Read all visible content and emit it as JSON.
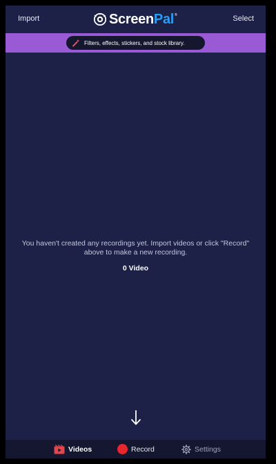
{
  "topbar": {
    "import_label": "Import",
    "select_label": "Select",
    "logo_text_a": "Screen",
    "logo_text_b": "Pal",
    "logo_tm": "®"
  },
  "promo": {
    "text": "Filters, effects, stickers, and stock library."
  },
  "empty_state": {
    "message": "You haven't created any recordings yet. Import videos or click \"Record\" above to make a new recording.",
    "count": "0 Video"
  },
  "bottomnav": {
    "videos_label": "Videos",
    "record_label": "Record",
    "settings_label": "Settings"
  },
  "colors": {
    "background": "#1d2148",
    "promo_band": "#9a5ad6",
    "brand_blue": "#2a9df4",
    "record_red": "#e8262e",
    "videos_icon_red": "#e0474c"
  },
  "icons": {
    "logo": "screenpal-eye-logo",
    "promo": "magic-wand-icon",
    "videos": "video-film-icon",
    "record": "record-dot-icon",
    "settings": "gear-icon",
    "hint": "arrow-down-icon"
  }
}
